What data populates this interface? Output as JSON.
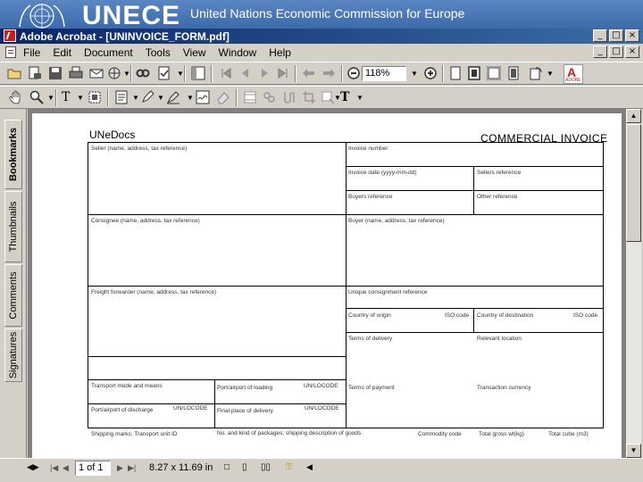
{
  "banner": {
    "logo_text": "UNECE",
    "org_name": "United Nations Economic Commission for Europe"
  },
  "window": {
    "title": "Adobe Acrobat - [UNINVOICE_FORM.pdf]",
    "minimize": "_",
    "maximize": "□",
    "close": "×"
  },
  "menu": [
    "File",
    "Edit",
    "Document",
    "Tools",
    "View",
    "Window",
    "Help"
  ],
  "toolbar": {
    "zoom": "118%"
  },
  "sidetabs": [
    "Bookmarks",
    "Thumbnails",
    "Comments",
    "Signatures"
  ],
  "status": {
    "page": "1 of 1",
    "size": "8.27 x 11.69 in"
  },
  "form": {
    "header_left": "UNeDocs",
    "header_right": "COMMERCIAL INVOICE",
    "seller": "Seller (name, address, tax reference)",
    "invoice_number": "Invoice number",
    "invoice_date": "Invoice date (yyyy-mm-dd)",
    "sellers_reference": "Sellers reference",
    "buyers_reference": "Buyers reference",
    "other_reference": "Other reference",
    "consignee": "Consignee (name, address, tax reference)",
    "buyer": "Buyer (name, address, tax reference)",
    "freight_forwarder": "Freight forwarder (name, address, tax reference)",
    "unique_consignment": "Unique consignment reference",
    "country_origin": "Country of origin",
    "iso_code_1": "ISO code",
    "country_destination": "Country of destination",
    "iso_code_2": "ISO code",
    "terms_delivery": "Terms of delivery",
    "relevant_location": "Relevant location",
    "transport_mode": "Transport mode and means",
    "port_loading": "Port/airport of loading",
    "unlocode_1": "UN/LOCODE",
    "terms_payment": "Terms of payment",
    "transaction_currency": "Transaction currency",
    "port_discharge": "Port/airport of discharge",
    "unlocode_2": "UN/LOCODE",
    "final_delivery": "Final place of delivery",
    "unlocode_3": "UN/LOCODE",
    "shipping_marks": "Shipping marks; Transport unit ID",
    "packages": "No. and kind of packages; shipping description of goods",
    "commodity_code": "Commodity code",
    "total_gross": "Total gross wt(kg)",
    "total_cube": "Total cube (m3)"
  }
}
